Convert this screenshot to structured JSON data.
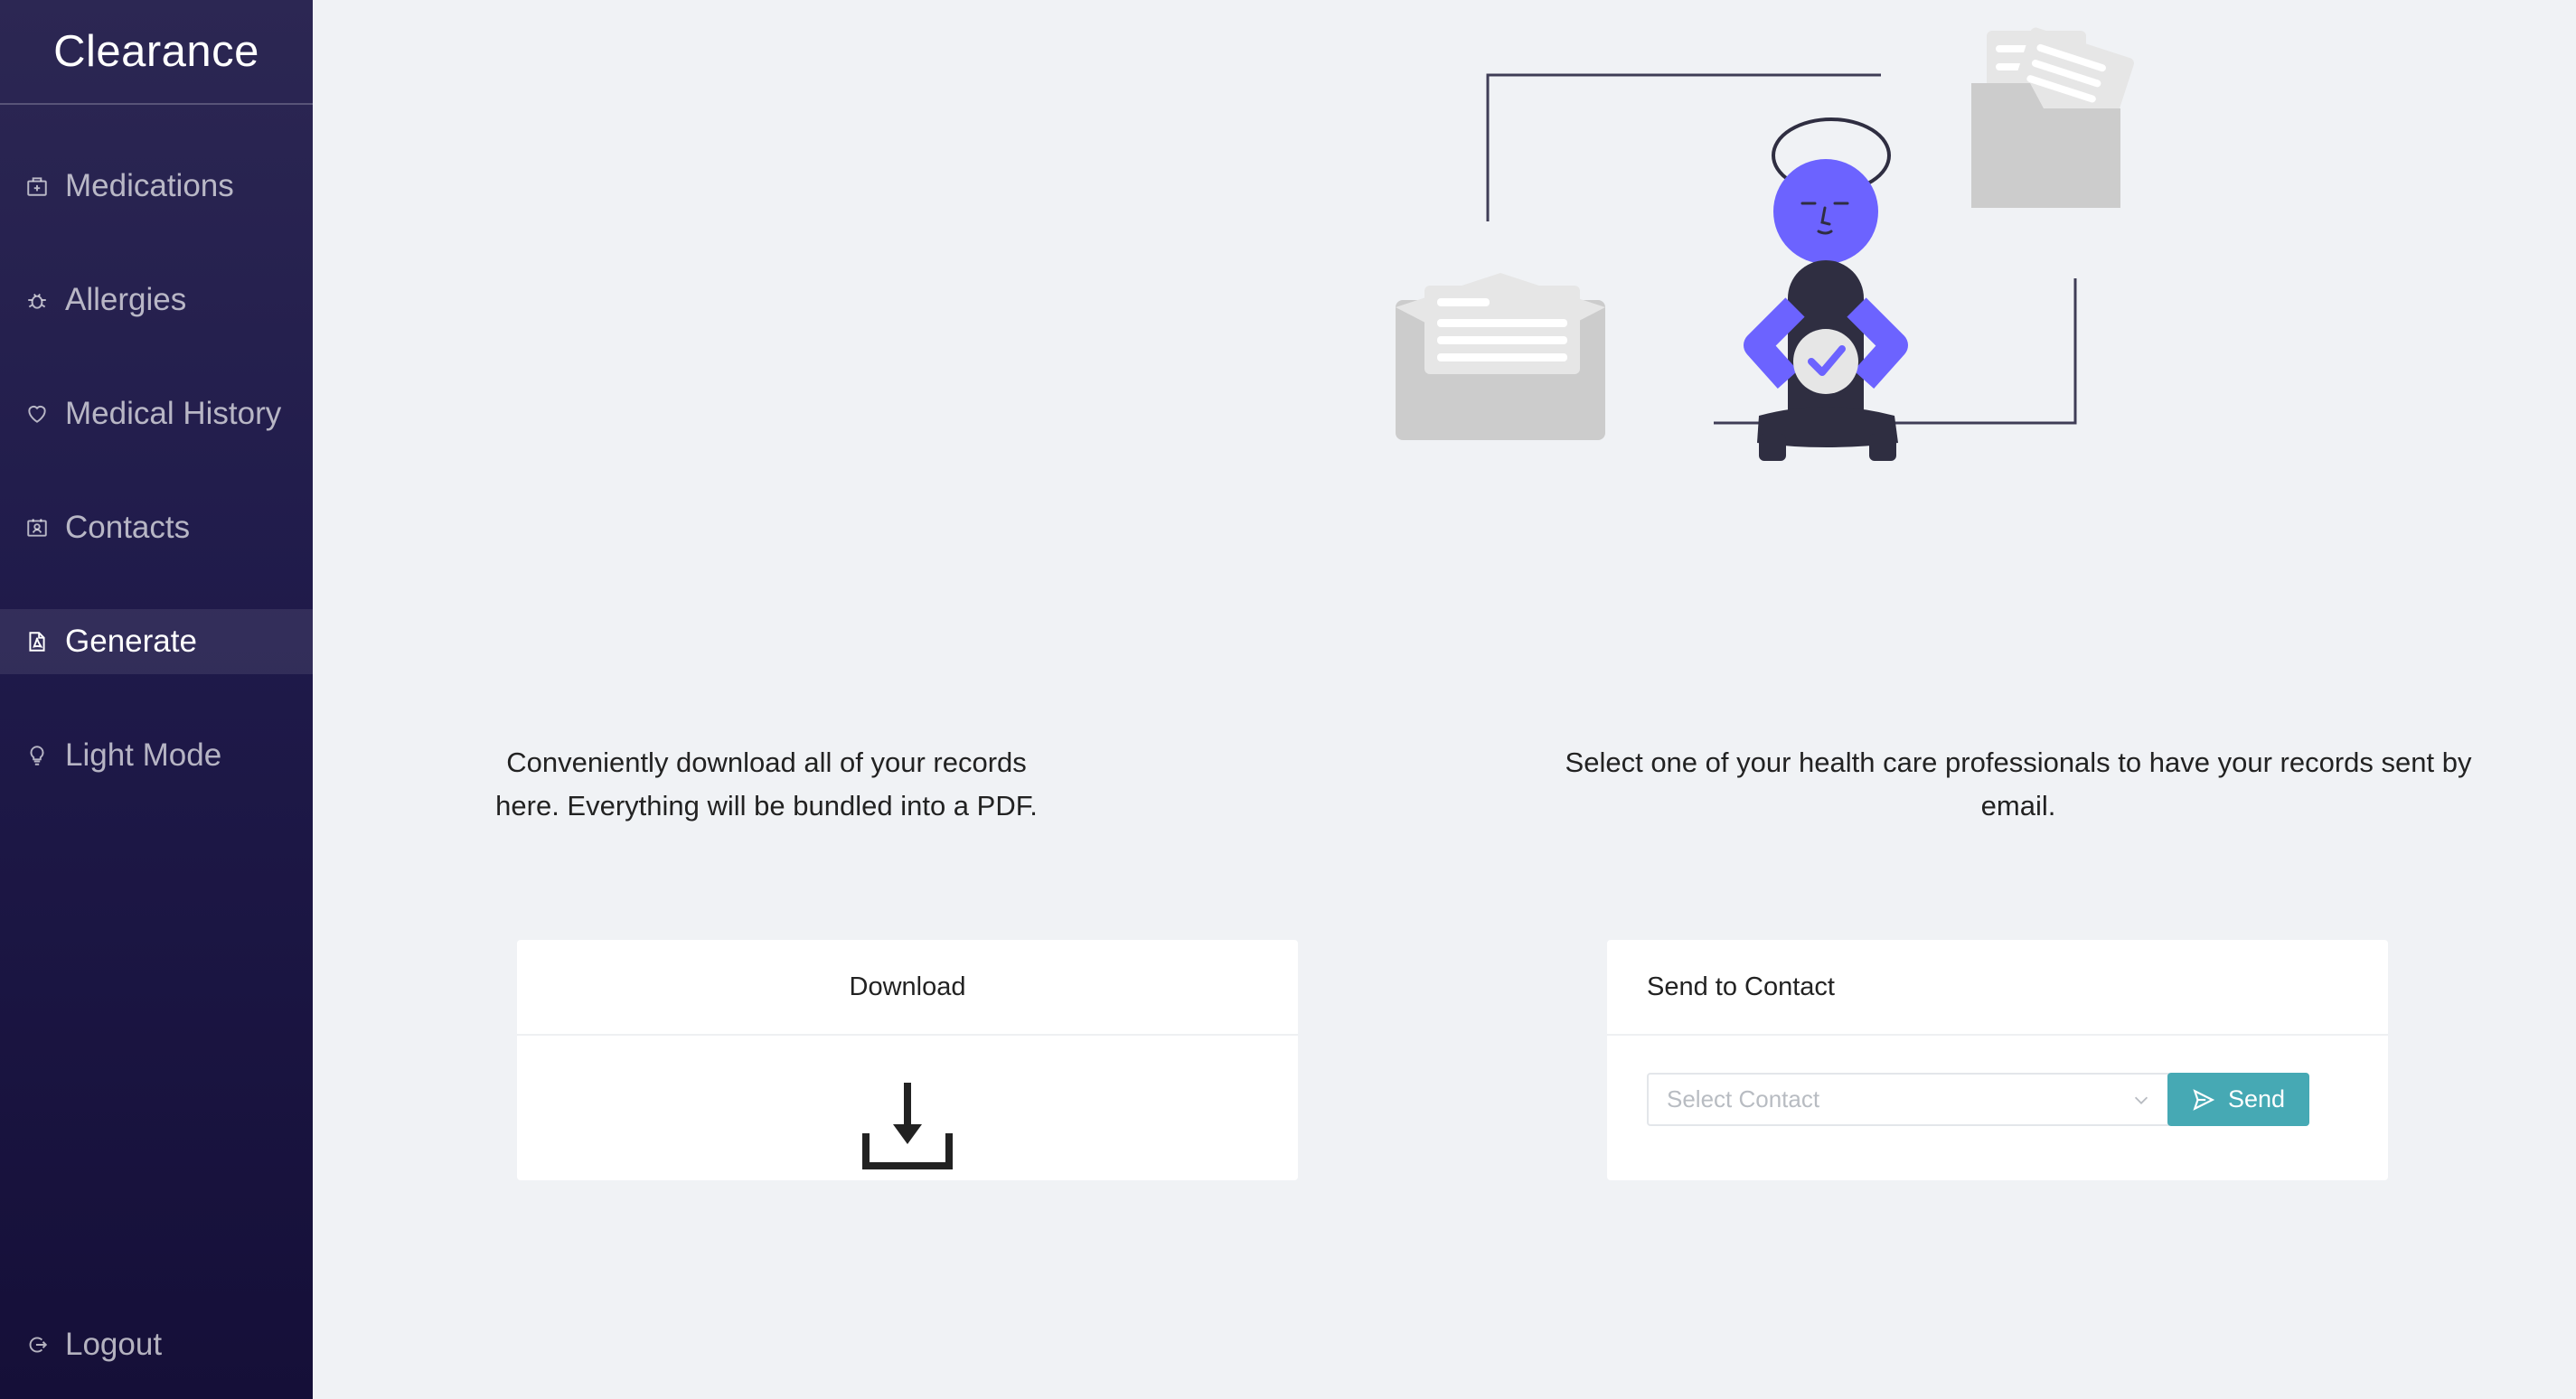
{
  "app": {
    "title": "Clearance"
  },
  "sidebar": {
    "items": [
      {
        "label": "Medications",
        "icon": "medicine-box-icon"
      },
      {
        "label": "Allergies",
        "icon": "bug-icon"
      },
      {
        "label": "Medical History",
        "icon": "heart-icon"
      },
      {
        "label": "Contacts",
        "icon": "contacts-icon"
      },
      {
        "label": "Generate",
        "icon": "file-pdf-icon",
        "active": true
      },
      {
        "label": "Light Mode",
        "icon": "bulb-icon"
      }
    ],
    "logout": {
      "label": "Logout",
      "icon": "logout-icon"
    }
  },
  "download": {
    "description": "Conveniently download all of your records here. Everything will be bundled into a PDF.",
    "card_title": "Download",
    "icon": "download-icon"
  },
  "send": {
    "description": "Select one of your health care professionals to have your records sent by email.",
    "card_title": "Send to Contact",
    "select_placeholder": "Select Contact",
    "button_label": "Send",
    "button_icon": "send-icon"
  },
  "colors": {
    "sidebar_top": "#2c2753",
    "sidebar_bottom": "#150f38",
    "accent": "#46a9b4",
    "illustration_purple": "#6c63ff",
    "illustration_dark": "#2f2e41"
  }
}
